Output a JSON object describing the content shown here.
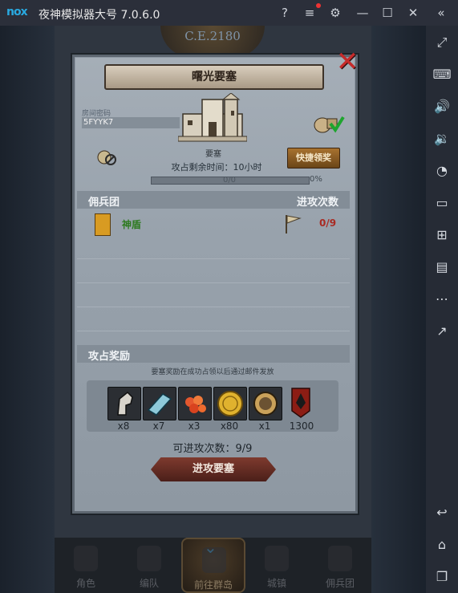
{
  "titlebar": {
    "logo": "nox",
    "title": "夜神模拟器大号 7.0.6.0",
    "icons": [
      "help-icon",
      "menu-icon",
      "settings-icon",
      "minimize-icon",
      "maximize-icon",
      "close-icon",
      "collapse-icon"
    ]
  },
  "sidebar": {
    "icons": [
      "fullscreen-icon",
      "keyboard-icon",
      "volume-up-icon",
      "volume-down-icon",
      "record-icon",
      "screen-icon",
      "apk-icon",
      "multi-instance-icon",
      "more-icon",
      "share-icon",
      "back-icon",
      "home-icon",
      "recent-icon"
    ]
  },
  "game": {
    "banner": "C.E.2180",
    "dialog": {
      "title": "曙光要塞",
      "close_icon": "x-close-icon",
      "room_code_label": "房间密码",
      "room_code": "5FYYK7",
      "castle_label": "要塞",
      "quick_claim": "快捷领奖",
      "remaining_time": "攻占剩余时间：10小时",
      "progress_text": "0/0",
      "progress_value": 0,
      "progress_percent": "0%",
      "mercenary_header": "佣兵团",
      "attack_header": "进攻次数",
      "mercenary_name": "神盾",
      "attack_count": "0/9",
      "reward_header": "攻占奖励",
      "reward_note": "要塞奖励在成功占领以后通过邮件发放",
      "rewards": [
        {
          "icon": "horse-icon",
          "count": "x8"
        },
        {
          "icon": "cloth-icon",
          "count": "x7"
        },
        {
          "icon": "gems-icon",
          "count": "x3"
        },
        {
          "icon": "gold-coin-icon",
          "count": "x80"
        },
        {
          "icon": "helmet-icon",
          "count": "x1"
        },
        {
          "icon": "badge-icon",
          "count": "1300"
        }
      ],
      "attempts": "可进攻次数：9/9",
      "attack_button": "进攻要塞"
    },
    "bottom_nav": [
      {
        "label": "角色"
      },
      {
        "label": "编队"
      },
      {
        "label": "前往群岛"
      },
      {
        "label": "城镇"
      },
      {
        "label": "佣兵团"
      }
    ]
  },
  "colors": {
    "accent_red": "#c62b2b",
    "merc_green": "#2d7a1f",
    "count_red": "#a92a22"
  }
}
